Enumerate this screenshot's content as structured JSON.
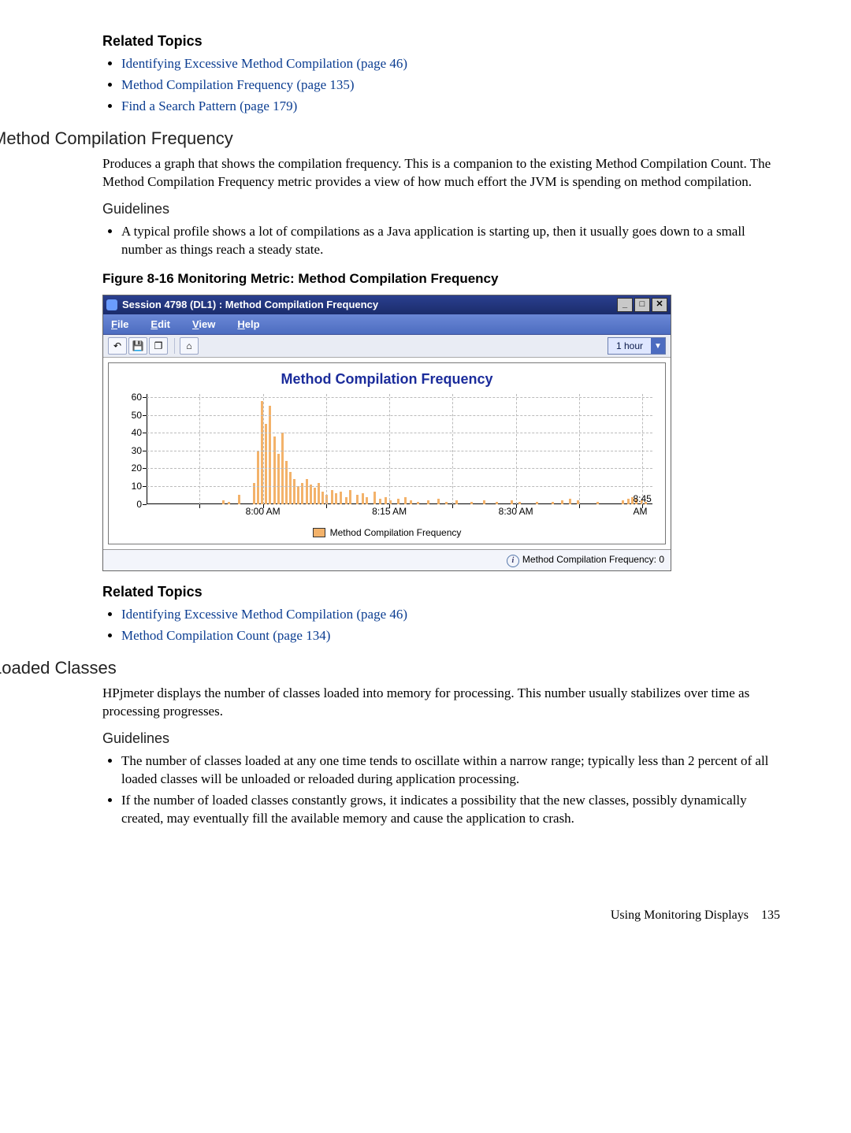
{
  "top_related": {
    "heading": "Related Topics",
    "items": [
      "Identifying Excessive Method Compilation (page 46)",
      "Method Compilation Frequency (page 135)",
      "Find a Search Pattern (page 179)"
    ]
  },
  "section_mcf": {
    "heading": "Method Compilation Frequency",
    "para": "Produces a graph that shows the compilation frequency. This is a companion to the existing Method Compilation Count. The Method Compilation Frequency metric provides a view of how much effort the JVM is spending on method compilation.",
    "guidelines_heading": "Guidelines",
    "guidelines": [
      "A typical profile shows a lot of compilations as a Java application is starting up, then it usually goes down to a small number as things reach a steady state."
    ],
    "figure_caption": "Figure 8-16 Monitoring Metric: Method Compilation Frequency"
  },
  "window": {
    "title": "Session 4798 (DL1) : Method Compilation Frequency",
    "menus": {
      "file": "File",
      "edit": "Edit",
      "view": "View",
      "help": "Help"
    },
    "timerange": "1 hour",
    "chart_title": "Method Compilation Frequency",
    "legend": "Method Compilation Frequency",
    "status": "Method Compilation Frequency: 0"
  },
  "mcf_related": {
    "heading": "Related Topics",
    "items": [
      "Identifying Excessive Method Compilation (page 46)",
      "Method Compilation Count (page 134)"
    ]
  },
  "section_loaded": {
    "heading": "Loaded Classes",
    "para": "HPjmeter displays the number of classes loaded into memory for processing. This number usually stabilizes over time as processing progresses.",
    "guidelines_heading": "Guidelines",
    "guidelines": [
      "The number of classes loaded at any one time tends to oscillate within a narrow range; typically less than 2 percent of all loaded classes will be unloaded or reloaded during application processing.",
      "If the number of loaded classes constantly grows, it indicates a possibility that the new classes, possibly dynamically created, may eventually fill the available memory and cause the application to crash."
    ]
  },
  "footer": {
    "section": "Using Monitoring Displays",
    "page": "135"
  },
  "chart_data": {
    "type": "bar",
    "title": "Method Compilation Frequency",
    "series_name": "Method Compilation Frequency",
    "ylabel": "",
    "xlabel": "",
    "ylim": [
      0,
      62
    ],
    "yticks": [
      0,
      10,
      20,
      30,
      40,
      50,
      60
    ],
    "xticks": [
      {
        "label": "8:00 AM",
        "frac": 0.23
      },
      {
        "label": "8:15 AM",
        "frac": 0.48
      },
      {
        "label": "8:30 AM",
        "frac": 0.73
      },
      {
        "label": "8:45 AM",
        "frac": 0.98
      }
    ],
    "xgrid_fracs": [
      0.105,
      0.23,
      0.355,
      0.48,
      0.605,
      0.73,
      0.855,
      0.98
    ],
    "points": [
      {
        "x": 0.15,
        "y": 2
      },
      {
        "x": 0.16,
        "y": 1
      },
      {
        "x": 0.18,
        "y": 5
      },
      {
        "x": 0.21,
        "y": 12
      },
      {
        "x": 0.218,
        "y": 30
      },
      {
        "x": 0.226,
        "y": 58
      },
      {
        "x": 0.234,
        "y": 45
      },
      {
        "x": 0.242,
        "y": 55
      },
      {
        "x": 0.25,
        "y": 38
      },
      {
        "x": 0.258,
        "y": 28
      },
      {
        "x": 0.266,
        "y": 40
      },
      {
        "x": 0.274,
        "y": 24
      },
      {
        "x": 0.282,
        "y": 18
      },
      {
        "x": 0.29,
        "y": 14
      },
      {
        "x": 0.298,
        "y": 10
      },
      {
        "x": 0.306,
        "y": 12
      },
      {
        "x": 0.314,
        "y": 14
      },
      {
        "x": 0.322,
        "y": 11
      },
      {
        "x": 0.33,
        "y": 9
      },
      {
        "x": 0.338,
        "y": 12
      },
      {
        "x": 0.346,
        "y": 7
      },
      {
        "x": 0.354,
        "y": 5
      },
      {
        "x": 0.365,
        "y": 8
      },
      {
        "x": 0.373,
        "y": 6
      },
      {
        "x": 0.381,
        "y": 7
      },
      {
        "x": 0.392,
        "y": 4
      },
      {
        "x": 0.4,
        "y": 8
      },
      {
        "x": 0.415,
        "y": 5
      },
      {
        "x": 0.425,
        "y": 6
      },
      {
        "x": 0.433,
        "y": 4
      },
      {
        "x": 0.448,
        "y": 7
      },
      {
        "x": 0.46,
        "y": 3
      },
      {
        "x": 0.47,
        "y": 4
      },
      {
        "x": 0.48,
        "y": 2
      },
      {
        "x": 0.495,
        "y": 3
      },
      {
        "x": 0.51,
        "y": 4
      },
      {
        "x": 0.52,
        "y": 2
      },
      {
        "x": 0.535,
        "y": 1
      },
      {
        "x": 0.555,
        "y": 2
      },
      {
        "x": 0.575,
        "y": 3
      },
      {
        "x": 0.59,
        "y": 1
      },
      {
        "x": 0.61,
        "y": 2
      },
      {
        "x": 0.64,
        "y": 1
      },
      {
        "x": 0.665,
        "y": 2
      },
      {
        "x": 0.69,
        "y": 1
      },
      {
        "x": 0.72,
        "y": 2
      },
      {
        "x": 0.735,
        "y": 1
      },
      {
        "x": 0.77,
        "y": 1
      },
      {
        "x": 0.8,
        "y": 1
      },
      {
        "x": 0.82,
        "y": 2
      },
      {
        "x": 0.835,
        "y": 3
      },
      {
        "x": 0.85,
        "y": 2
      },
      {
        "x": 0.89,
        "y": 1
      },
      {
        "x": 0.94,
        "y": 2
      },
      {
        "x": 0.95,
        "y": 3
      },
      {
        "x": 0.958,
        "y": 4
      },
      {
        "x": 0.966,
        "y": 3
      },
      {
        "x": 0.976,
        "y": 2
      },
      {
        "x": 0.985,
        "y": 1
      }
    ]
  }
}
